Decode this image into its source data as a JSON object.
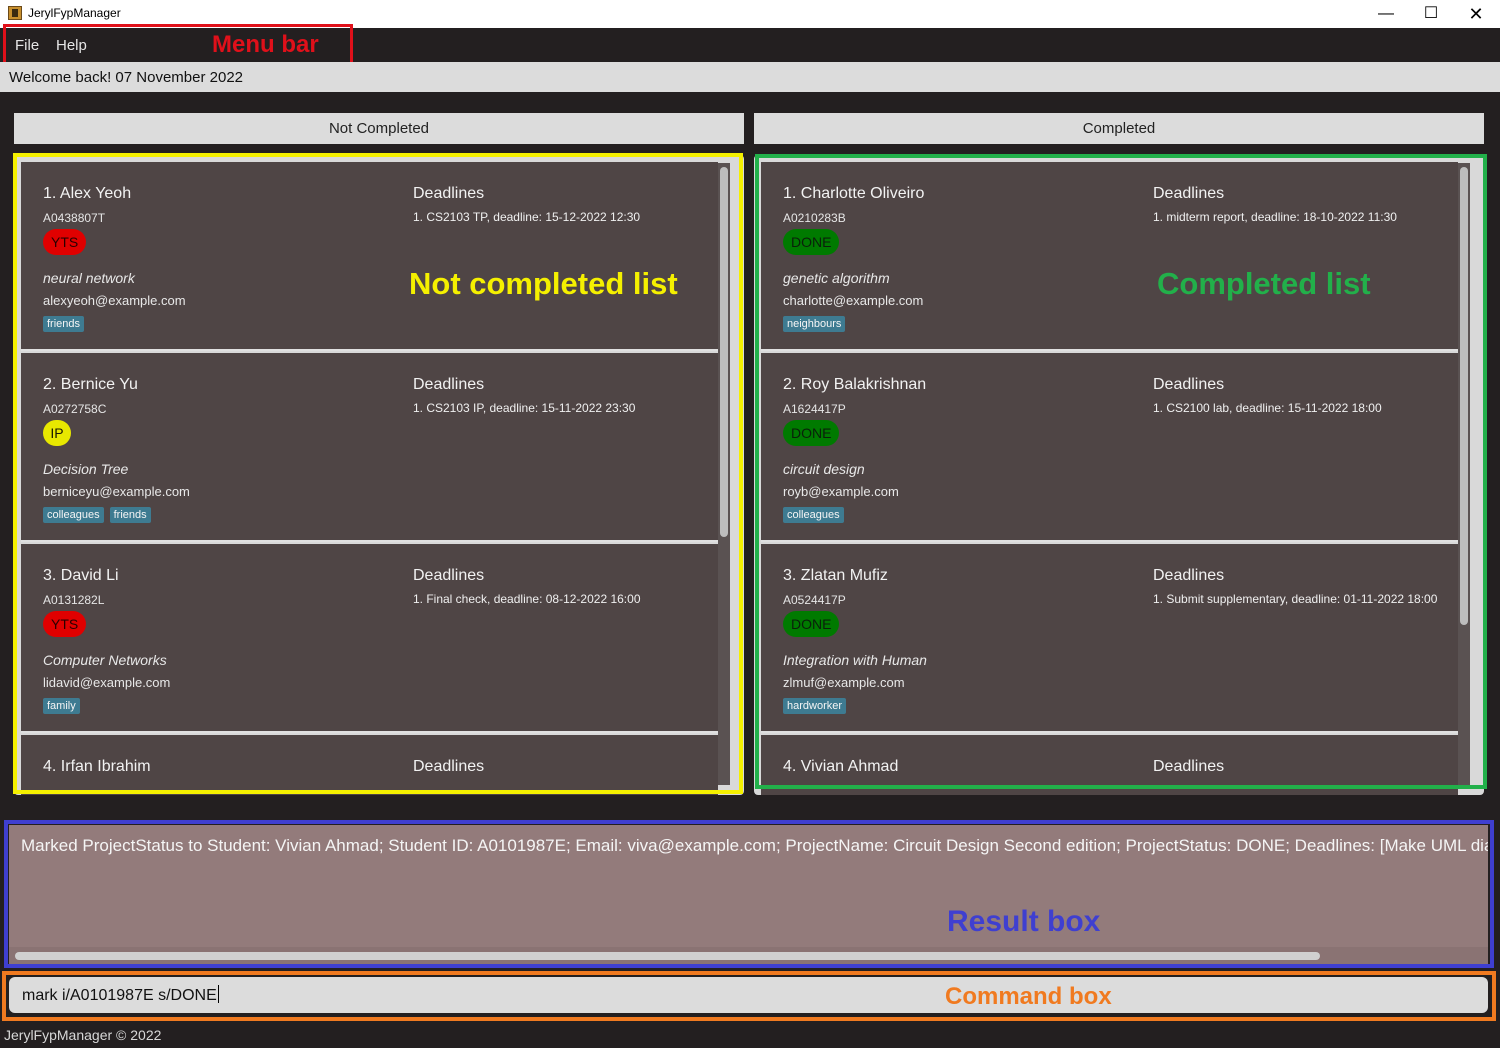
{
  "window": {
    "title": "JerylFypManager"
  },
  "menu": {
    "file": "File",
    "help": "Help"
  },
  "welcome": "Welcome back! 07 November 2022",
  "columns": {
    "left": "Not Completed",
    "right": "Completed"
  },
  "annotations": {
    "menu_bar": "Menu bar",
    "not_completed_list": "Not completed list",
    "completed_list": "Completed list",
    "result_box": "Result box",
    "command_box": "Command box",
    "colors": {
      "red": "#e0101a",
      "yellow": "#f5f000",
      "green": "#22b04a",
      "blue": "#3f3fd0",
      "orange": "#f07a20"
    }
  },
  "deadlines_label": "Deadlines",
  "not_completed": [
    {
      "name": "1.  Alex Yeoh",
      "id": "A0438807T",
      "status": "YTS",
      "project": "neural network",
      "email": "alexyeoh@example.com",
      "tags": [
        "friends"
      ],
      "deadline": "1. CS2103 TP, deadline: 15-12-2022 12:30"
    },
    {
      "name": "2.  Bernice Yu",
      "id": "A0272758C",
      "status": "IP",
      "project": "Decision Tree",
      "email": "berniceyu@example.com",
      "tags": [
        "colleagues",
        "friends"
      ],
      "deadline": "1. CS2103 IP, deadline: 15-11-2022 23:30"
    },
    {
      "name": "3.  David Li",
      "id": "A0131282L",
      "status": "YTS",
      "project": "Computer Networks",
      "email": "lidavid@example.com",
      "tags": [
        "family"
      ],
      "deadline": "1. Final check, deadline: 08-12-2022 16:00"
    },
    {
      "name": "4.  Irfan Ibrahim",
      "id": "",
      "status": "",
      "project": "",
      "email": "",
      "tags": [],
      "deadline": ""
    }
  ],
  "completed": [
    {
      "name": "1.  Charlotte Oliveiro",
      "id": "A0210283B",
      "status": "DONE",
      "project": "genetic algorithm",
      "email": "charlotte@example.com",
      "tags": [
        "neighbours"
      ],
      "deadline": "1. midterm report, deadline: 18-10-2022 11:30"
    },
    {
      "name": "2.  Roy Balakrishnan",
      "id": "A1624417P",
      "status": "DONE",
      "project": "circuit design",
      "email": "royb@example.com",
      "tags": [
        "colleagues"
      ],
      "deadline": "1. CS2100 lab, deadline: 15-11-2022 18:00"
    },
    {
      "name": "3.  Zlatan Mufiz",
      "id": "A0524417P",
      "status": "DONE",
      "project": "Integration with Human",
      "email": "zlmuf@example.com",
      "tags": [
        "hardworker"
      ],
      "deadline": "1. Submit supplementary, deadline: 01-11-2022 18:00"
    },
    {
      "name": "4.  Vivian Ahmad",
      "id": "",
      "status": "",
      "project": "",
      "email": "",
      "tags": [],
      "deadline": ""
    }
  ],
  "result": "Marked ProjectStatus to Student: Vivian Ahmad; Student ID: A0101987E; Email: viva@example.com; ProjectName: Circuit Design Second edition; ProjectStatus: DONE; Deadlines: [Make UML dia",
  "command": "mark i/A0101987E s/DONE",
  "footer": "JerylFypManager © 2022"
}
